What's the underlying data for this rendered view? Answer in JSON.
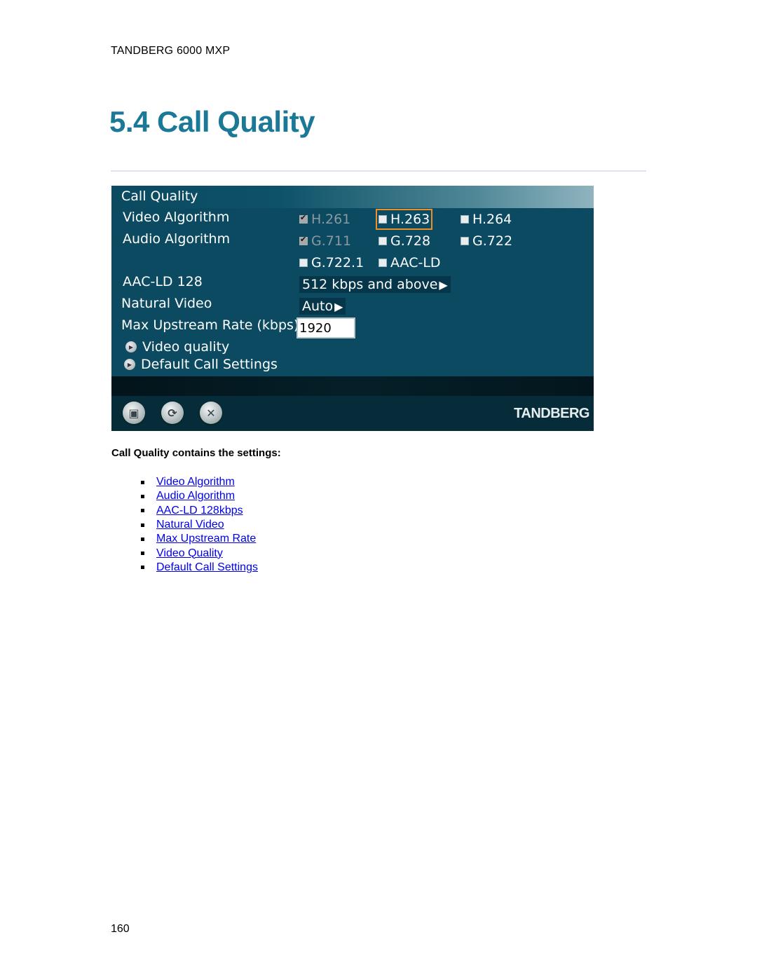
{
  "document": {
    "running_header": "TANDBERG 6000 MXP",
    "title": "5.4 Call Quality",
    "page_number": "160",
    "colors": {
      "title": "#1b7896",
      "link": "#0000ee",
      "screen_bg": "#0b4a60",
      "focus_outline": "#e8902a"
    }
  },
  "screen": {
    "header_title": "Call Quality",
    "rows": {
      "video_algorithm": {
        "label": "Video Algorithm",
        "options": [
          {
            "label": "H.261",
            "checked": true,
            "disabled": true
          },
          {
            "label": "H.263",
            "checked": false,
            "disabled": false,
            "focused": true
          },
          {
            "label": "H.264",
            "checked": false,
            "disabled": false
          }
        ]
      },
      "audio_algorithm": {
        "label": "Audio Algorithm",
        "options": [
          {
            "label": "G.711",
            "checked": true,
            "disabled": true
          },
          {
            "label": "G.728",
            "checked": false,
            "disabled": false
          },
          {
            "label": "G.722",
            "checked": false,
            "disabled": false
          },
          {
            "label": "G.722.1",
            "checked": false,
            "disabled": false
          },
          {
            "label": "AAC-LD",
            "checked": false,
            "disabled": false
          }
        ]
      },
      "aac_ld_128": {
        "label": "AAC-LD 128",
        "value": "512 kbps and above"
      },
      "natural_video": {
        "label": "Natural Video",
        "value": "Auto"
      },
      "max_upstream_rate": {
        "label": "Max Upstream Rate (kbps)",
        "value": "1920"
      }
    },
    "submenus": [
      "Video quality",
      "Default Call Settings"
    ],
    "footer": {
      "buttons": [
        {
          "name": "save",
          "icon": "floppy-disk-icon"
        },
        {
          "name": "refresh",
          "icon": "refresh-icon"
        },
        {
          "name": "close",
          "icon": "close-icon"
        }
      ],
      "brand": "TANDBERG"
    }
  },
  "body": {
    "lead": "Call Quality contains the settings:",
    "links": [
      "Video Algorithm",
      "Audio Algorithm",
      "AAC-LD 128kbps",
      "Natural Video",
      "Max Upstream Rate",
      "Video Quality",
      "Default Call Settings"
    ]
  }
}
